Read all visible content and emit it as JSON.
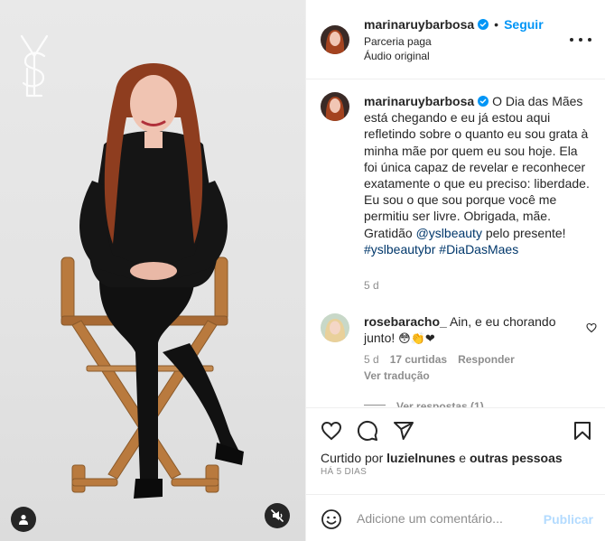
{
  "header": {
    "username": "marinaruybarbosa",
    "separator": "•",
    "follow_label": "Seguir",
    "subtitle_partnership": "Parceria paga",
    "subtitle_audio": "Áudio original"
  },
  "caption": {
    "username": "marinaruybarbosa",
    "text_1": "O Dia das Mães está chegando e eu já estou aqui refletindo sobre o quanto eu sou grata à minha mãe por quem eu sou hoje. Ela foi única capaz de revelar e reconhecer exatamente o que eu preciso: liberdade. Eu sou o que sou porque você me permitiu ser livre. Obrigada, mãe. Gratidão ",
    "mention": "@yslbeauty",
    "text_2": " pelo presente! ",
    "hashtag_1": "#yslbeautybr",
    "hashtag_2": "#DiaDasMaes",
    "time": "5 d"
  },
  "comment": {
    "username": "rosebaracho_",
    "text": "Ain, e eu chorando junto!",
    "emojis": "😳👏❤",
    "time": "5 d",
    "likes": "17 curtidas",
    "reply_label": "Responder",
    "translate_label": "Ver tradução",
    "view_replies": "Ver respostas (1)"
  },
  "likes": {
    "prefix": "Curtido por ",
    "user": "luzielnunes",
    "middle": " e ",
    "others": "outras pessoas"
  },
  "post_age": "HÁ 5 DIAS",
  "add_comment": {
    "placeholder": "Adicione um comentário...",
    "publish_label": "Publicar"
  },
  "icons": {
    "verified": "verified-badge-icon",
    "more": "more-options-icon",
    "like": "heart-icon",
    "comment": "comment-icon",
    "share": "share-icon",
    "save": "bookmark-icon",
    "emoji": "emoji-icon",
    "mute": "muted-speaker-icon",
    "tags": "user-tag-icon"
  },
  "colors": {
    "accent": "#0095f6",
    "verified": "#0095f6",
    "link": "#00376b",
    "muted": "#8e8e8e",
    "publish_disabled": "#b3dbff"
  }
}
